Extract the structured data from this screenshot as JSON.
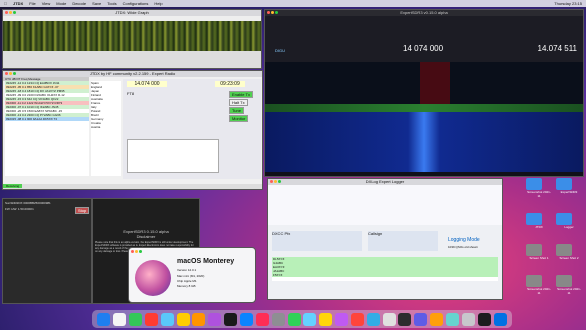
{
  "menubar": {
    "apple": "",
    "app": "JTDX",
    "items": [
      "File",
      "View",
      "Mode",
      "Decode",
      "Save",
      "Tools",
      "Configurations",
      "Help"
    ],
    "right": "Thursday 23:15"
  },
  "waterfall_window": {
    "title": "JTDX: Wide Graph"
  },
  "jtdx_main": {
    "title": "JTDX by HF community v2.2.159 - Expert Radio",
    "freq": "14.074 000",
    "time": "09:23:09",
    "mode": "FT8",
    "buttons": [
      "Enable Tx",
      "Halt Tx",
      "Tune",
      "Monitor"
    ],
    "utc": "UTC   dB   DT  Freq  Message",
    "rows": [
      "092245 -12 0.2 1234 CQ EA3BOX JN11",
      "092245 -05 0.1  856 K1ABC G4XYZ -07",
      "092245 -18 0.4 1810 CQ DX JA1XYZ PM95",
      "092245 -09 0.0 2100 DL5ABC OH2XX R-12",
      "092245 -15 0.3  642 CQ VK3ABC QF22",
      "092300 -11 0.2 1422 W1AW F5XYZ RR73",
      "092300 -07 0.1 1010 CQ IK2ABC JN45",
      "092300 -20 0.5 1500 EA8XX SP9ABC -15",
      "092300 -13 0.2 2300 CQ PY2ABC GG66",
      "092315 -08 0.1  900 9A1AA DK5XX 73"
    ],
    "countries": [
      "Spain",
      "England",
      "Japan",
      "Finland",
      "Australia",
      "France",
      "Italy",
      "Poland",
      "Brazil",
      "Germany",
      "Croatia",
      "Austria"
    ],
    "status": "Receiving"
  },
  "expertsdr": {
    "title": "ExpertSDR3 v0.15.0 alpha",
    "freq": "14 074 000",
    "freq_right": "14.074 511",
    "mode": "DIGU"
  },
  "logger": {
    "title": "DXLog Expert Logger",
    "sections": [
      "DXCC Pfx",
      "Callsign",
      "Logging Mode"
    ],
    "mode_line": "1039 QSOs old shown",
    "callsigns": [
      "DL5XYZ",
      "G4ABC",
      "EA3XYZ",
      "JA1ABC",
      "F5XYZ"
    ]
  },
  "terminal": {
    "title": "SunSDR2DX 0000BB2500000981",
    "line1": "FW: HW: 1.50.0000/1",
    "stop": "Stop"
  },
  "disclaimer": {
    "title": "ExpertSDR3 0.15.0 alpha",
    "heading": "Disclaimer",
    "text": "Please note that this is an alpha version, the ExpertSDR3 is still under development. The ExpertSDR3 software is provided as is. Expert Electronics does not take responsibility for any damage as a result of the use of this software. We do not assume the use of software on any damage or loss. Please report any software problem to us."
  },
  "about_mac": {
    "title": "macOS Monterey",
    "version": "Version 12.0.1",
    "l1": "Mac mini (M1, 2020)",
    "l2": "Chip Apple M1",
    "l3": "Memory 8 GB"
  },
  "desktop_icons": [
    "Screenshot 2021-11",
    "ExpertSDR3",
    "JTDX",
    "Logger",
    "Screen Shot 1",
    "Screen Shot 2",
    "Screenshot 2021-11",
    "Screenshot 2021-11"
  ],
  "dock_colors": [
    "#1e7ef0",
    "#f5f5f5",
    "#34c759",
    "#ff3b30",
    "#5ac8fa",
    "#ffcc00",
    "#ff9500",
    "#af52de",
    "#1a1a1a",
    "#0a84ff",
    "#ff2d55",
    "#8e8e93",
    "#30d158",
    "#64d2ff",
    "#ffd60a",
    "#bf5af2",
    "#ff453a",
    "#32ade6",
    "#e0e0e0",
    "#2c2c2e",
    "#5e5ce6",
    "#ff9f0a",
    "#66d4cf",
    "#c7c7cc",
    "#1c1c1e",
    "#0071e3"
  ]
}
